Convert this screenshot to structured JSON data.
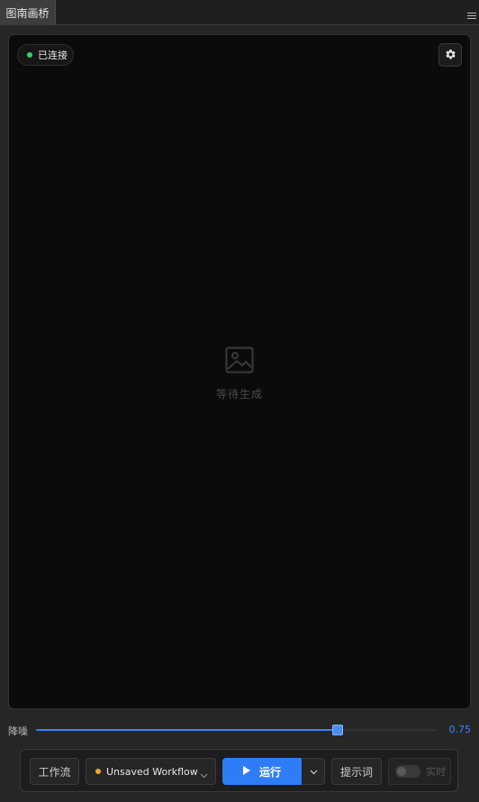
{
  "panel": {
    "tab_title": "图南画桥",
    "menu_icon": "hamburger-icon"
  },
  "status": {
    "label": "已连接",
    "dot_color": "#3ecf6e"
  },
  "preview": {
    "placeholder_icon": "image-icon",
    "placeholder_text": "等待生成"
  },
  "settings": {
    "icon": "gear-icon"
  },
  "denoise": {
    "label": "降噪",
    "value": "0.75",
    "fraction": 0.75,
    "accent": "#3b82f6"
  },
  "toolbar": {
    "workflow_label": "工作流",
    "workflow_select": "Unsaved Workflow",
    "workflow_dot_color": "#f5a524",
    "run_label": "运行",
    "run_color": "#2f7df6",
    "prompt_label": "提示词",
    "realtime_label": "实时",
    "realtime_on": false
  }
}
